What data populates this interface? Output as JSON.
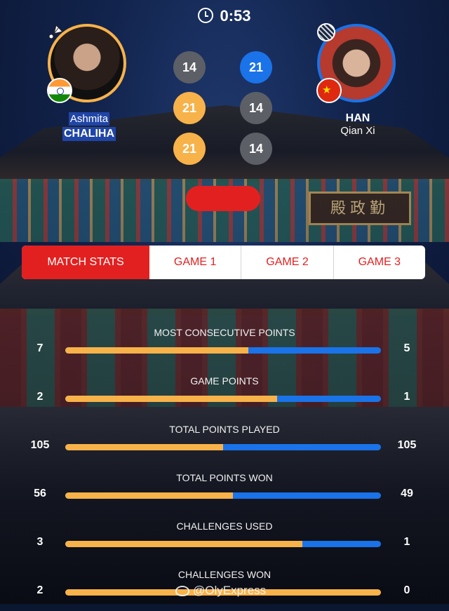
{
  "timer": {
    "value": "0:53"
  },
  "players": {
    "left": {
      "first_name": "Ashmita",
      "last_name": "CHALIHA",
      "flag": "india-flag",
      "icon": "shuttlecock-icon",
      "color": "#f7b24a"
    },
    "right": {
      "first_name": "Qian Xi",
      "last_name": "HAN",
      "flag": "china-flag",
      "icon": "racket-icon",
      "color": "#1a73e8"
    }
  },
  "games": [
    {
      "left": "14",
      "right": "21",
      "winner": "right"
    },
    {
      "left": "21",
      "right": "14",
      "winner": "left"
    },
    {
      "left": "21",
      "right": "14",
      "winner": "left"
    }
  ],
  "tabs": [
    {
      "label": "MATCH STATS",
      "active": true
    },
    {
      "label": "GAME 1",
      "active": false
    },
    {
      "label": "GAME 2",
      "active": false
    },
    {
      "label": "GAME 3",
      "active": false
    }
  ],
  "stats": [
    {
      "label": "MOST CONSECUTIVE POINTS",
      "left": "7",
      "right": "5",
      "left_share": 0.58
    },
    {
      "label": "GAME POINTS",
      "left": "2",
      "right": "1",
      "left_share": 0.67
    },
    {
      "label": "TOTAL POINTS PLAYED",
      "left": "105",
      "right": "105",
      "left_share": 0.5
    },
    {
      "label": "TOTAL POINTS WON",
      "left": "56",
      "right": "49",
      "left_share": 0.53
    },
    {
      "label": "CHALLENGES USED",
      "left": "3",
      "right": "1",
      "left_share": 0.75
    },
    {
      "label": "CHALLENGES WON",
      "left": "2",
      "right": "0",
      "left_share": 1.0
    }
  ],
  "colors": {
    "accent_red": "#e32020",
    "left_gold": "#f7b24a",
    "right_blue": "#1a73e8",
    "loser_gray": "#5c5f66"
  },
  "watermark": {
    "text": "@OlyExpress"
  }
}
